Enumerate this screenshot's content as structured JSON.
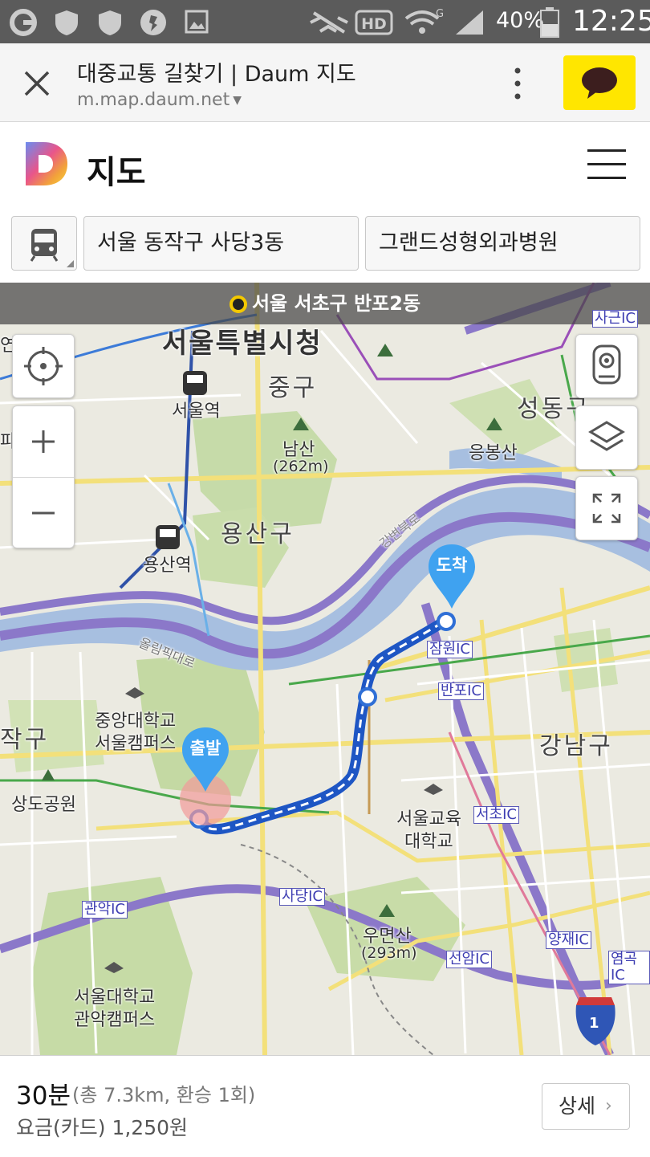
{
  "status_bar": {
    "battery_text": "40%",
    "time": "12:25",
    "icons": [
      "g-icon",
      "shield-icon",
      "shield-icon",
      "app-icon",
      "image-icon",
      "mute-icon",
      "hd-icon",
      "wifi-icon",
      "signal-icon",
      "battery-icon"
    ]
  },
  "browser": {
    "title": "대중교통 길찾기 | Daum 지도",
    "url": "m.map.daum.net"
  },
  "app": {
    "title": "지도"
  },
  "search": {
    "origin": "서울 동작구 사당3동",
    "destination": "그랜드성형외과병원"
  },
  "map": {
    "location_banner": "서울 서초구 반포2동",
    "labels": {
      "city_hall": "서울특별시청",
      "jung_gu": "중구",
      "seoul_station": "서울역",
      "namsan": "남산",
      "namsan_height": "(262m)",
      "yongsan_gu": "용산구",
      "yongsan_station": "용산역",
      "seongdong": "성동구",
      "eungbongsan": "응봉산",
      "gangbyeon_road": "강변북로",
      "olympic_road": "올림픽대로",
      "chungang_univ_1": "중앙대학교",
      "chungang_univ_2": "서울캠퍼스",
      "gangnam_gu": "강남구",
      "seoul_edu_univ_1": "서울교육",
      "seoul_edu_univ_2": "대학교",
      "sangdo_park": "상도공원",
      "umyeonsan": "우면산",
      "umyeonsan_height": "(293m)",
      "snu_1": "서울대학교",
      "snu_2": "관악캠퍼스",
      "jak_gu": "작구",
      "yeon": "연",
      "pa": "파"
    },
    "ic_labels": {
      "sageun": "사근IC",
      "jamwon": "잠원IC",
      "banpo": "반포IC",
      "seocho": "서초IC",
      "sadang": "사당IC",
      "gwanak": "관악IC",
      "seonam": "선암IC",
      "yangjae": "양재IC",
      "yeomgok": "염곡IC"
    },
    "highway_shield": "1",
    "start_pin": "출발",
    "end_pin": "도착"
  },
  "route_summary": {
    "duration": "30분",
    "distance": "(총 7.3km, 환승 1회)",
    "fare": "요금(카드) 1,250원",
    "detail_button": "상세"
  },
  "colors": {
    "kakao_yellow": "#ffe600",
    "route_blue": "#2f6fd6",
    "pin_blue": "#3fa2f0",
    "river": "#a7bfe0",
    "expressway": "#8b78c9"
  }
}
